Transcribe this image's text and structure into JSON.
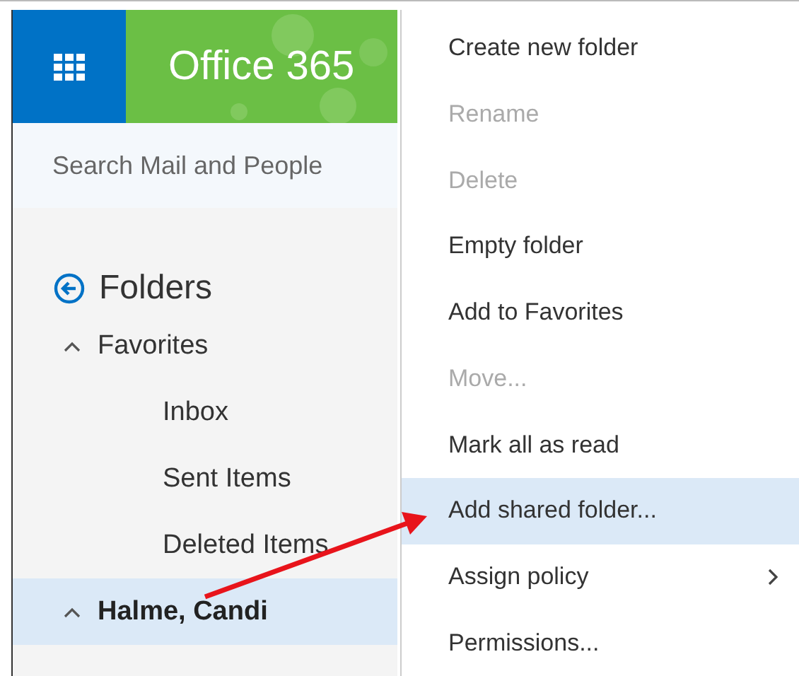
{
  "header": {
    "app_title": "Office 365"
  },
  "search": {
    "placeholder": "Search Mail and People"
  },
  "folders": {
    "title": "Folders",
    "groups": [
      {
        "label": "Favorites",
        "expanded": true,
        "selected": false,
        "children": [
          {
            "label": "Inbox",
            "selected": false
          },
          {
            "label": "Sent Items",
            "selected": false
          },
          {
            "label": "Deleted Items",
            "selected": false
          }
        ]
      },
      {
        "label": "Halme, Candi",
        "expanded": true,
        "selected": true
      }
    ]
  },
  "context_menu": {
    "items": [
      {
        "label": "Create new folder",
        "disabled": false,
        "selected": false,
        "submenu": false
      },
      {
        "label": "Rename",
        "disabled": true,
        "selected": false,
        "submenu": false
      },
      {
        "label": "Delete",
        "disabled": true,
        "selected": false,
        "submenu": false
      },
      {
        "label": "Empty folder",
        "disabled": false,
        "selected": false,
        "submenu": false
      },
      {
        "label": "Add to Favorites",
        "disabled": false,
        "selected": false,
        "submenu": false
      },
      {
        "label": "Move...",
        "disabled": true,
        "selected": false,
        "submenu": false
      },
      {
        "label": "Mark all as read",
        "disabled": false,
        "selected": false,
        "submenu": false
      },
      {
        "label": "Add shared folder...",
        "disabled": false,
        "selected": true,
        "submenu": false
      },
      {
        "label": "Assign policy",
        "disabled": false,
        "selected": false,
        "submenu": true
      },
      {
        "label": "Permissions...",
        "disabled": false,
        "selected": false,
        "submenu": false
      }
    ]
  }
}
